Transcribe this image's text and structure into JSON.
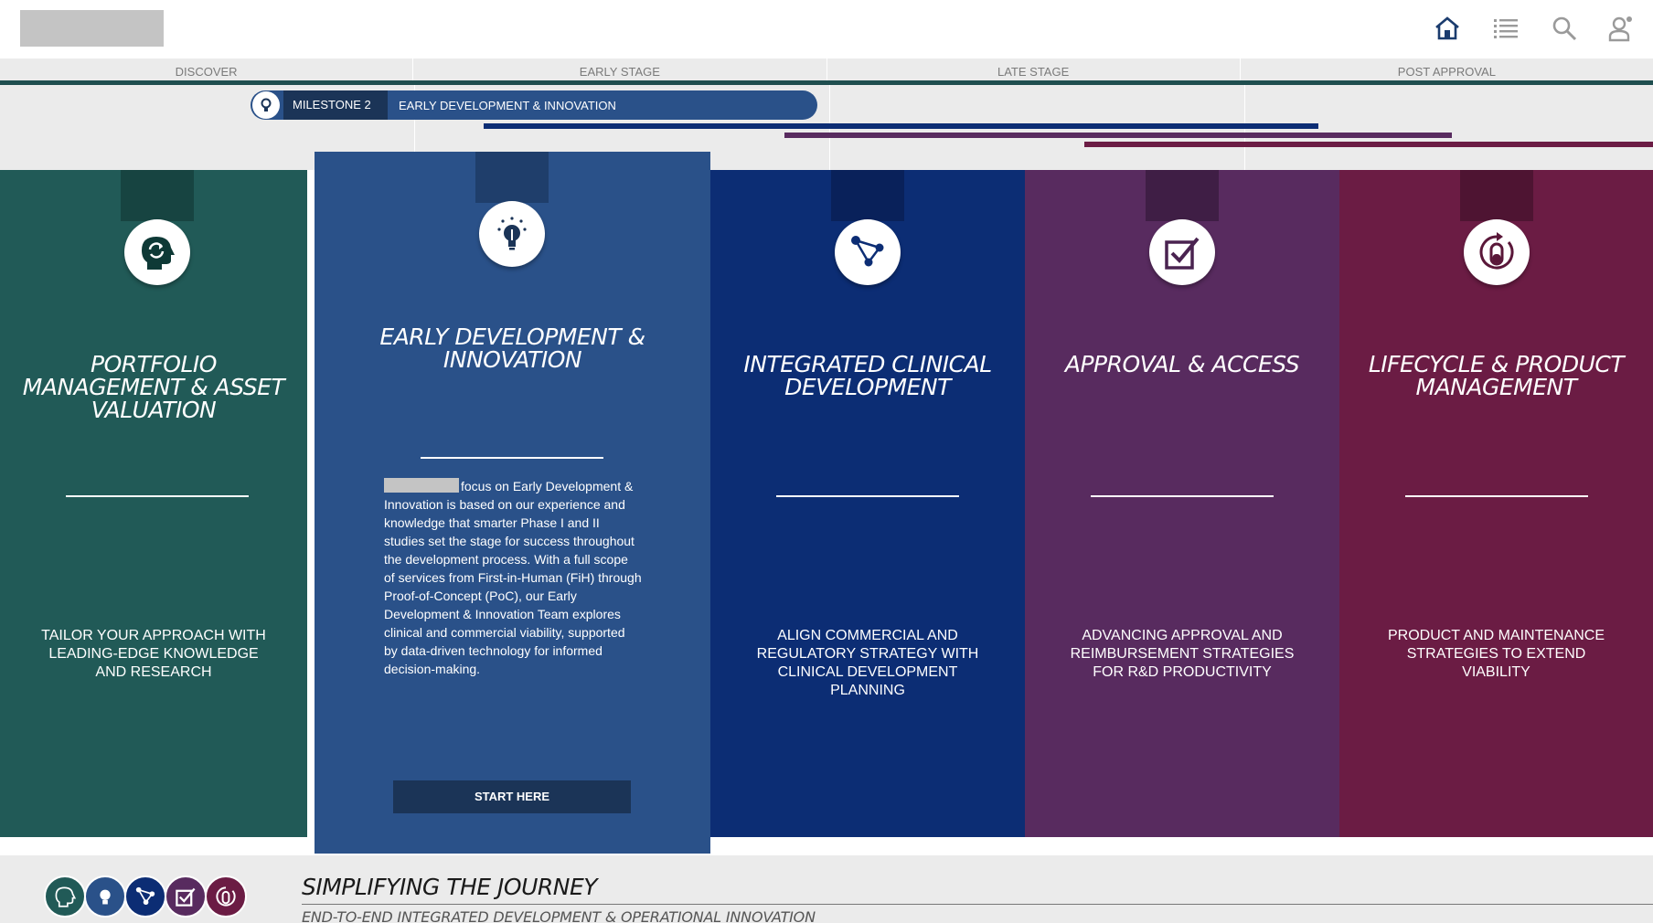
{
  "header": {
    "icons": [
      "home-icon",
      "list-icon",
      "search-icon",
      "user-icon"
    ]
  },
  "stages": [
    "DISCOVER",
    "EARLY STAGE",
    "LATE STAGE",
    "POST APPROVAL"
  ],
  "milestone": {
    "number": "MILESTONE 2",
    "label": "EARLY DEVELOPMENT & INNOVATION",
    "icon": "lightbulb-icon"
  },
  "columns": [
    {
      "id": "portfolio",
      "title": "PORTFOLIO MANAGEMENT & ASSET VALUATION",
      "description": "TAILOR YOUR APPROACH WITH LEADING-EDGE KNOWLEDGE AND RESEARCH",
      "color": "#215a57",
      "tab_color": "#174441",
      "icon": "head-cycle-icon"
    },
    {
      "id": "early-development",
      "title": "EARLY DEVELOPMENT & INNOVATION",
      "body": "focus on Early Development & Innovation is based on our experience and knowledge that smarter Phase I and II studies set the stage for success throughout the development process. With a full scope of services from First-in-Human (FiH) through Proof-of-Concept (PoC), our Early Development & Innovation Team explores clinical and commercial viability, supported by data-driven technology for informed decision-making.",
      "button": "START HERE",
      "color": "#2a5189",
      "tab_color": "#1f3e6b",
      "icon": "lightbulb-icon"
    },
    {
      "id": "integrated-clinical",
      "title": "INTEGRATED CLINICAL DEVELOPMENT",
      "description": "ALIGN COMMERCIAL AND REGULATORY STRATEGY WITH CLINICAL DEVELOPMENT PLANNING",
      "color": "#0c2d74",
      "tab_color": "#09215a",
      "icon": "network-icon"
    },
    {
      "id": "approval",
      "title": "APPROVAL & ACCESS",
      "description": "ADVANCING APPROVAL AND REIMBURSEMENT STRATEGIES FOR R&D PRODUCTIVITY",
      "color": "#582b5f",
      "tab_color": "#3f1e45",
      "icon": "checkbox-icon"
    },
    {
      "id": "lifecycle",
      "title": "LIFECYCLE & PRODUCT MANAGEMENT",
      "description": "PRODUCT AND MAINTENANCE STRATEGIES TO EXTEND VIABILITY",
      "color": "#6b1c44",
      "tab_color": "#4e1432",
      "icon": "capsule-cycle-icon"
    }
  ],
  "footer": {
    "title": "SIMPLIFYING THE JOURNEY",
    "subtitle": "END-TO-END INTEGRATED DEVELOPMENT & OPERATIONAL INNOVATION"
  }
}
